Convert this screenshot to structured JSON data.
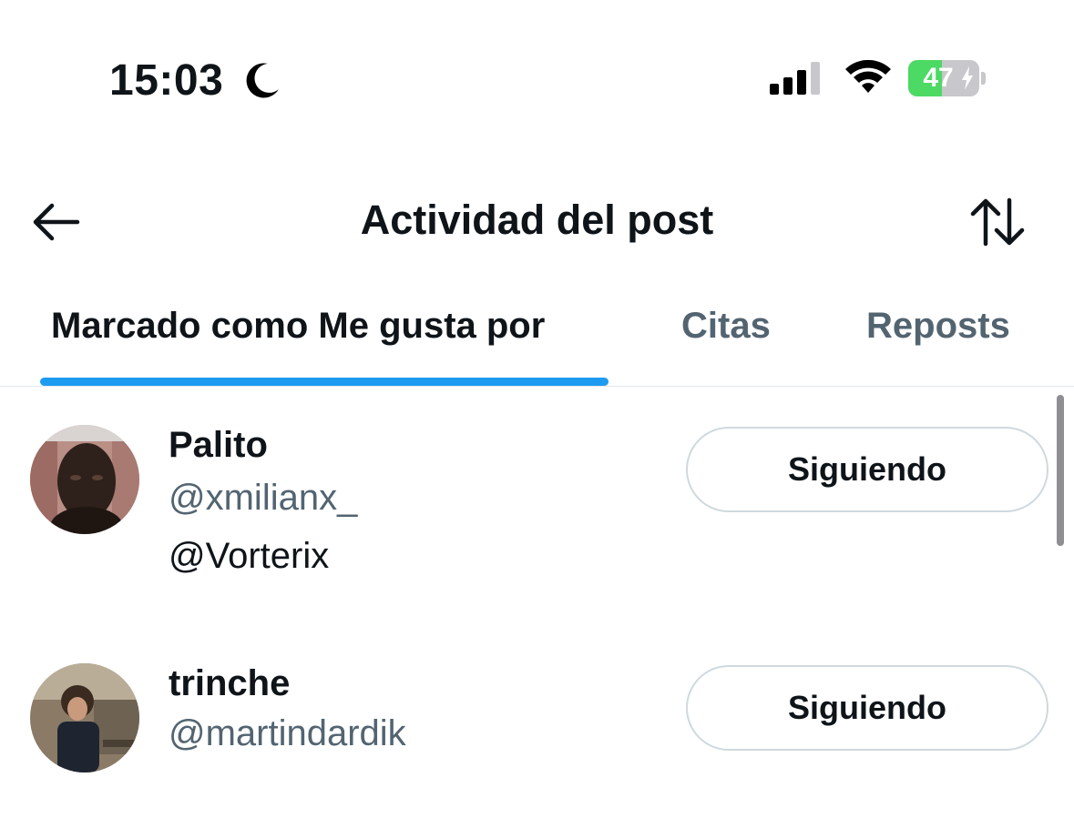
{
  "status_bar": {
    "time": "15:03",
    "battery_level": "47",
    "battery_fraction": 0.47,
    "icons": [
      "moon-icon",
      "cellular-signal-icon",
      "wifi-icon",
      "battery-charging-icon"
    ]
  },
  "header": {
    "title": "Actividad del post",
    "back_icon": "arrow-left-icon",
    "sort_icon": "sort-arrows-icon"
  },
  "tabs": [
    {
      "label": "Marcado como Me gusta por",
      "active": true
    },
    {
      "label": "Citas",
      "active": false
    },
    {
      "label": "Reposts",
      "active": false
    }
  ],
  "users": [
    {
      "name": "Palito",
      "handle": "@xmilianx_",
      "bio": "@Vorterix",
      "button": "Siguiendo"
    },
    {
      "name": "trinche",
      "handle": "@martindardik",
      "bio": "",
      "button": "Siguiendo"
    }
  ],
  "colors": {
    "accent": "#1d9bf0",
    "text_primary": "#0f1419",
    "text_secondary": "#536471",
    "border": "#cfd9de",
    "battery_green": "#4cd964"
  }
}
